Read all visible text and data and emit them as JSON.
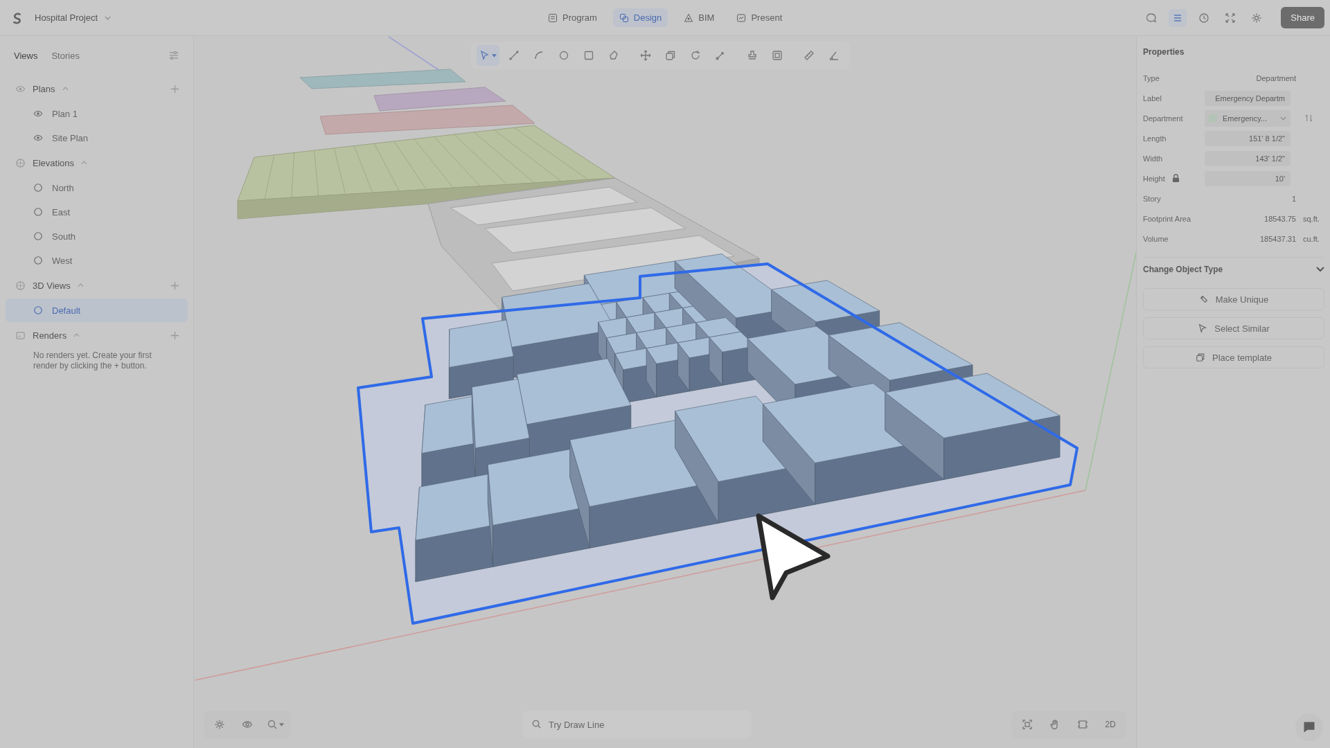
{
  "project": {
    "title": "Hospital Project"
  },
  "modes": [
    {
      "label": "Program",
      "kind": "program",
      "selected": false
    },
    {
      "label": "Design",
      "kind": "design",
      "selected": true
    },
    {
      "label": "BIM",
      "kind": "bim",
      "selected": false
    },
    {
      "label": "Present",
      "kind": "present",
      "selected": false
    }
  ],
  "header_tools": [
    {
      "kind": "chat",
      "selected": false
    },
    {
      "kind": "list",
      "selected": true
    },
    {
      "kind": "clock",
      "selected": false
    },
    {
      "kind": "expand",
      "selected": false
    },
    {
      "kind": "gear",
      "selected": false
    }
  ],
  "share_button": "Share",
  "sidebar": {
    "tabs": [
      {
        "label": "Views",
        "selected": true
      },
      {
        "label": "Stories",
        "selected": false
      }
    ],
    "groups": [
      {
        "label": "Plans",
        "kind": "plans",
        "expanded": true,
        "addable": true,
        "children": [
          {
            "label": "Plan 1",
            "selected": false
          },
          {
            "label": "Site Plan",
            "selected": false
          }
        ]
      },
      {
        "label": "Elevations",
        "kind": "elevations",
        "expanded": true,
        "addable": false,
        "children": [
          {
            "label": "North",
            "selected": false
          },
          {
            "label": "East",
            "selected": false
          },
          {
            "label": "South",
            "selected": false
          },
          {
            "label": "West",
            "selected": false
          }
        ]
      },
      {
        "label": "3D Views",
        "kind": "views3d",
        "expanded": true,
        "addable": true,
        "children": [
          {
            "label": "Default",
            "selected": true
          }
        ]
      },
      {
        "label": "Renders",
        "kind": "renders",
        "expanded": true,
        "addable": true,
        "empty_message": "No renders yet. Create your first render by clicking the + button."
      }
    ]
  },
  "tools": [
    {
      "kind": "select",
      "selected": true
    },
    {
      "kind": "line",
      "selected": false
    },
    {
      "kind": "arc",
      "selected": false
    },
    {
      "kind": "circle",
      "selected": false
    },
    {
      "kind": "rect",
      "selected": false
    },
    {
      "kind": "polygon",
      "selected": false
    },
    {
      "kind": "move",
      "selected": false
    },
    {
      "kind": "copy",
      "selected": false
    },
    {
      "kind": "rotate",
      "selected": false
    },
    {
      "kind": "scale",
      "selected": false
    },
    {
      "kind": "stamp",
      "selected": false
    },
    {
      "kind": "frame",
      "selected": false
    },
    {
      "kind": "ruler",
      "selected": false
    },
    {
      "kind": "angle",
      "selected": false
    }
  ],
  "properties": {
    "title": "Properties",
    "rows": [
      {
        "label": "Type",
        "kind": "plain",
        "value": "Department"
      },
      {
        "label": "Label",
        "kind": "field",
        "value": "Emergency Departm"
      },
      {
        "label": "Department",
        "kind": "select",
        "value": "Emergency...",
        "color": "#b3c4b6"
      },
      {
        "label": "Length",
        "kind": "field",
        "value": "151' 8 1/2\""
      },
      {
        "label": "Width",
        "kind": "field",
        "value": "143' 1/2\""
      },
      {
        "label": "Height",
        "kind": "field",
        "value": "10'",
        "locked": true
      },
      {
        "label": "Story",
        "kind": "plain",
        "value": "1"
      },
      {
        "label": "Footprint Area",
        "kind": "unit",
        "value": "18543.75",
        "unit": "sq.ft."
      },
      {
        "label": "Volume",
        "kind": "unit",
        "value": "185437.31",
        "unit": "cu.ft."
      }
    ],
    "section": {
      "title": "Change Object Type",
      "expanded": false
    },
    "actions": [
      {
        "label": "Make Unique",
        "kind": "unique"
      },
      {
        "label": "Select Similar",
        "kind": "similar"
      },
      {
        "label": "Place template",
        "kind": "template"
      }
    ]
  },
  "bottom_left": [
    {
      "kind": "settings"
    },
    {
      "kind": "eye"
    },
    {
      "kind": "zoom"
    }
  ],
  "command_search": {
    "placeholder": "Try Draw Line"
  },
  "bottom_right": [
    {
      "kind": "fit"
    },
    {
      "kind": "hand"
    },
    {
      "kind": "frame"
    },
    {
      "kind": "text",
      "label": "2D"
    }
  ]
}
